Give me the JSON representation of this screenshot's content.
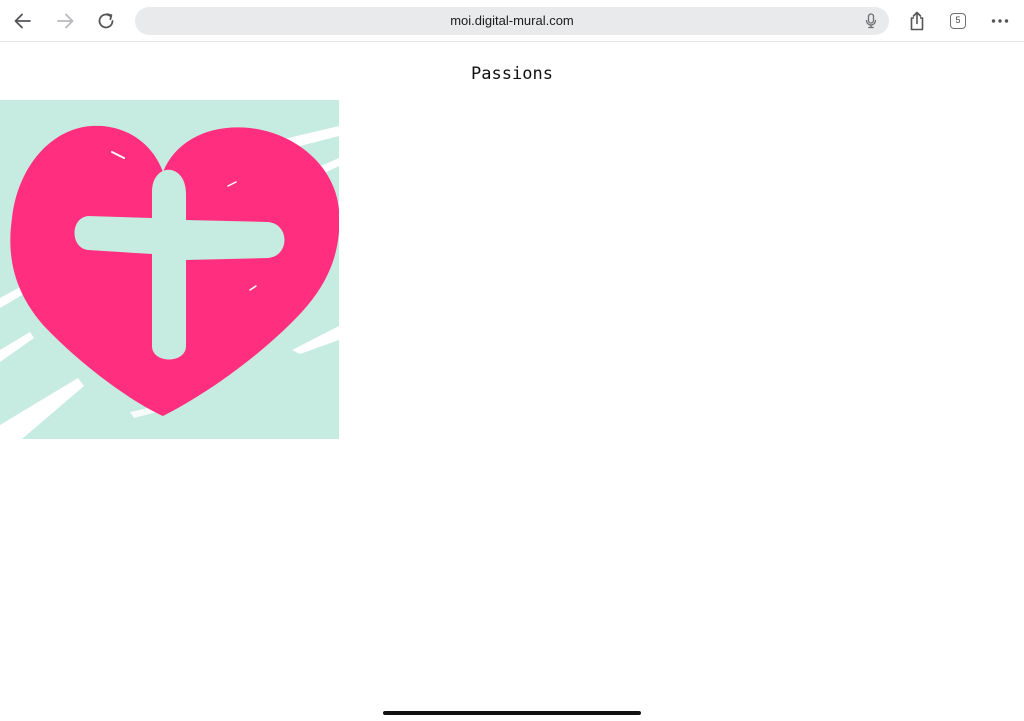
{
  "browser": {
    "url": "moi.digital-mural.com",
    "tab_count": "5",
    "icons": {
      "back": "arrow-left-icon",
      "forward": "arrow-right-icon",
      "reload": "reload-icon",
      "mic": "microphone-icon",
      "share": "share-icon",
      "tabs": "tabs-icon",
      "more": "more-dots-icon"
    }
  },
  "page": {
    "title": "Passions",
    "image": {
      "subject": "pink heart with plus sign on mint background",
      "colors": {
        "heart": "#ff2e7e",
        "background": "#c6ebe0",
        "accent": "#ffffff"
      }
    }
  }
}
